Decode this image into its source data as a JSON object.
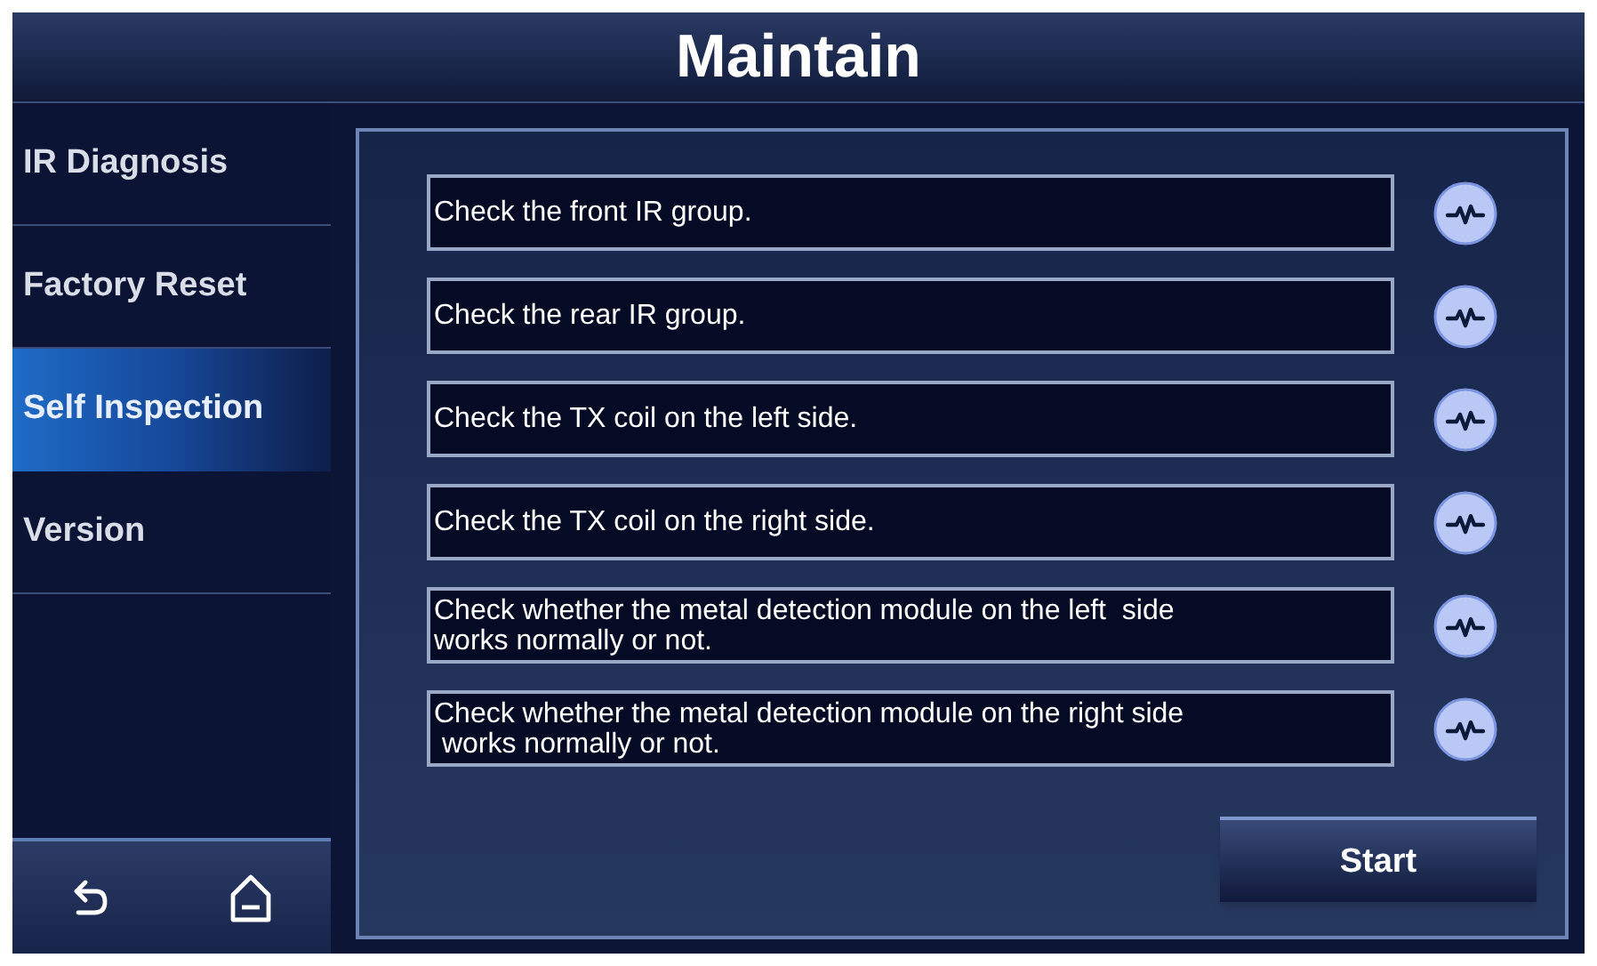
{
  "header": {
    "title": "Maintain"
  },
  "sidebar": {
    "items": [
      {
        "label": "IR Diagnosis",
        "selected": false
      },
      {
        "label": "Factory Reset",
        "selected": false
      },
      {
        "label": "Self Inspection",
        "selected": true
      },
      {
        "label": "Version",
        "selected": false
      }
    ]
  },
  "checks": [
    {
      "text": "Check the front IR group."
    },
    {
      "text": "Check the rear IR group."
    },
    {
      "text": "Check the TX coil on the left side."
    },
    {
      "text": "Check the TX coil on the right side."
    },
    {
      "text": "Check whether the metal detection module on the left  side\nworks normally or not."
    },
    {
      "text": "Check whether the metal detection module on the right side\n works normally or not."
    }
  ],
  "start_button": "Start"
}
